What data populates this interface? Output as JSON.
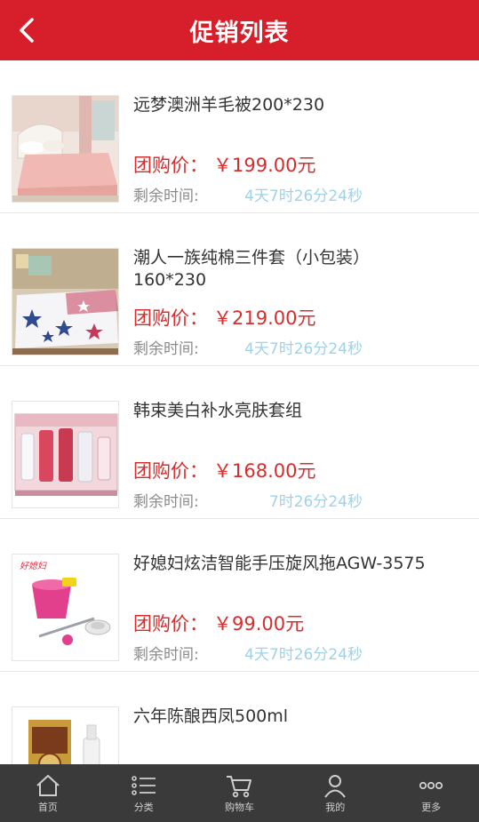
{
  "header": {
    "title": "促销列表",
    "back_icon": "chevron-left-icon"
  },
  "products": [
    {
      "name": "远梦澳洲羊毛被200*230",
      "price_label": "团购价：",
      "price": "￥199.00元",
      "remain_label": "剩余时间:",
      "countdown": "4天7时26分24秒"
    },
    {
      "name": "潮人一族纯棉三件套（小包装）160*230",
      "price_label": "团购价：",
      "price": "￥219.00元",
      "remain_label": "剩余时间:",
      "countdown": "4天7时26分24秒"
    },
    {
      "name": "韩束美白补水亮肤套组",
      "price_label": "团购价：",
      "price": "￥168.00元",
      "remain_label": "剩余时间:",
      "countdown": "7时26分24秒"
    },
    {
      "name": "好媳妇炫洁智能手压旋风拖AGW-3575",
      "price_label": "团购价：",
      "price": "￥99.00元",
      "remain_label": "剩余时间:",
      "countdown": "4天7时26分24秒"
    },
    {
      "name": "六年陈酿西凤500ml"
    }
  ],
  "tabbar": [
    {
      "label": "首页",
      "icon": "home-icon"
    },
    {
      "label": "分类",
      "icon": "list-icon"
    },
    {
      "label": "购物车",
      "icon": "cart-icon"
    },
    {
      "label": "我的",
      "icon": "user-icon"
    },
    {
      "label": "更多",
      "icon": "more-icon"
    }
  ],
  "colors": {
    "brand": "#d61f2a",
    "price": "#d62d2d",
    "countdown": "#9fd1e8",
    "tabbar": "#3a3a3a"
  }
}
